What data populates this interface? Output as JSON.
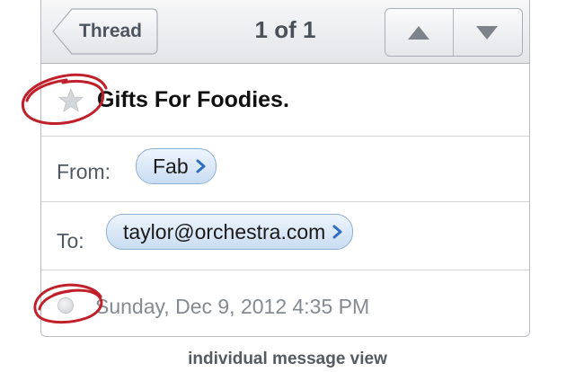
{
  "navbar": {
    "back_label": "Thread",
    "title": "1 of 1"
  },
  "message": {
    "subject": "Gifts For Foodies.",
    "from_label": "From:",
    "from_value": "Fab",
    "to_label": "To:",
    "to_value": "taylor@orchestra.com",
    "date": "Sunday, Dec 9, 2012 4:35 PM"
  },
  "caption": "individual message view",
  "colors": {
    "annotation": "#c0202a",
    "chip_border": "#8fb0d6",
    "chevron": "#2f6fc0"
  }
}
